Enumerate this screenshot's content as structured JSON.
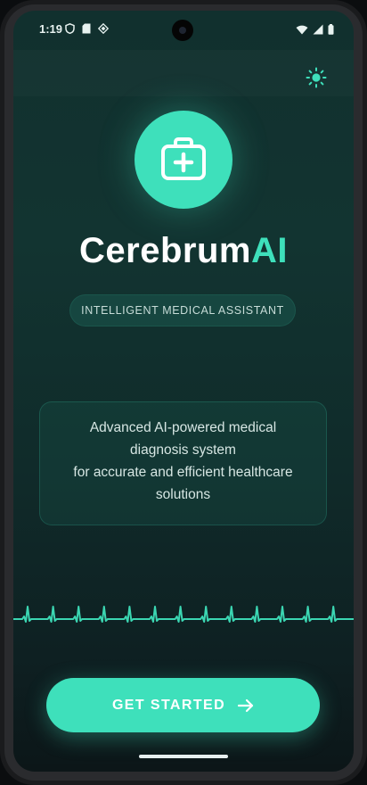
{
  "status_bar": {
    "time": "1:19"
  },
  "app": {
    "name_main": "Cerebrum",
    "name_accent": "AI"
  },
  "tagline": "INTELLIGENT MEDICAL ASSISTANT",
  "description": {
    "line1": "Advanced AI-powered medical",
    "line2": "diagnosis system",
    "line3": "for accurate and efficient healthcare",
    "line4": "solutions"
  },
  "cta": {
    "label": "GET STARTED",
    "icon": "arrow-right-icon"
  },
  "colors": {
    "accent": "#3ee0bb",
    "background": "#123431",
    "text": "#ffffff"
  }
}
